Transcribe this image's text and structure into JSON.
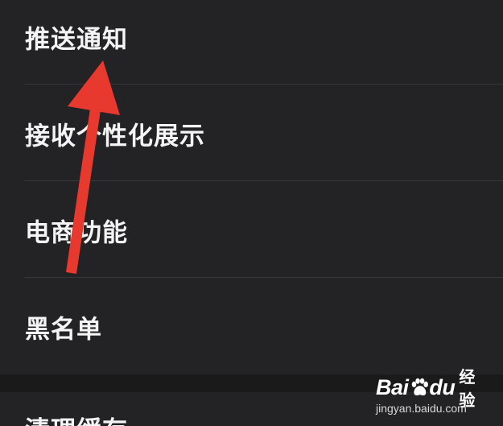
{
  "settings": {
    "items": [
      {
        "label": "推送通知"
      },
      {
        "label": "接收个性化展示"
      },
      {
        "label": "电商功能"
      },
      {
        "label": "黑名单"
      }
    ],
    "next_section": {
      "items": [
        {
          "label": "清理缓存"
        }
      ]
    }
  },
  "annotation": {
    "arrow_color": "#e8392e",
    "icon": "red-arrow-icon"
  },
  "watermark": {
    "logo_left": "Bai",
    "logo_right": "du",
    "product": "经验",
    "url": "jingyan.baidu.com"
  },
  "colors": {
    "background": "#232325",
    "text": "#f4f4f4",
    "divider": "#38383b",
    "section_gap": "#1a1a1b"
  }
}
